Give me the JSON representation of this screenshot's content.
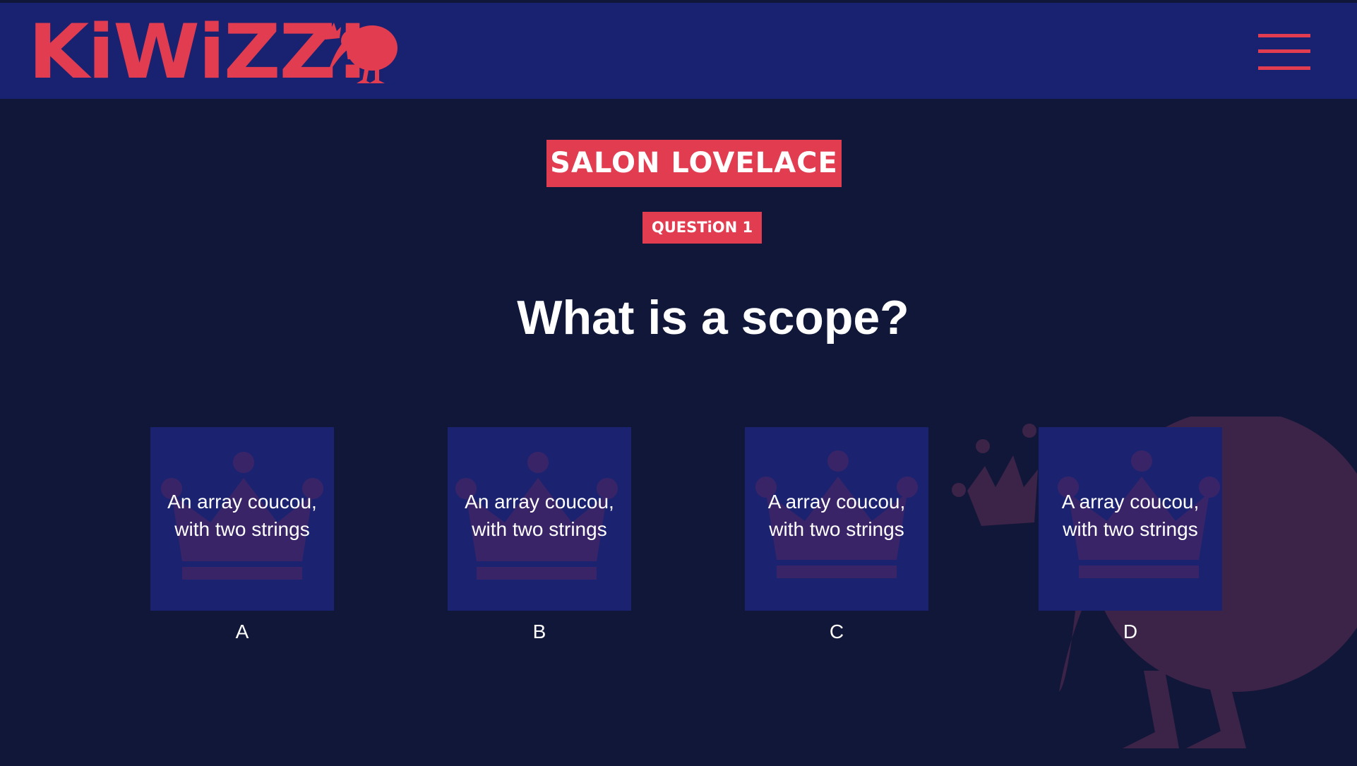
{
  "colors": {
    "background": "#111739",
    "header": "#192271",
    "accent": "#e23c51",
    "card": "#1b2370",
    "crown": "#3a2468",
    "text": "#ffffff"
  },
  "header": {
    "logo_text": "KiWiZZ!",
    "logo_icon": "kiwi-bird-crown-icon",
    "menu_icon": "hamburger-menu-icon"
  },
  "room": {
    "name": "SALON LOVELACE"
  },
  "question": {
    "label": "QUESTiON 1",
    "text": "What is a scope?"
  },
  "answers": [
    {
      "letter": "A",
      "text": "An array coucou, with two strings",
      "icon": "crown-icon"
    },
    {
      "letter": "B",
      "text": "An array coucou, with two strings",
      "icon": "crown-icon"
    },
    {
      "letter": "C",
      "text": "A array coucou, with two strings",
      "icon": "crown-icon"
    },
    {
      "letter": "D",
      "text": "A array coucou, with two strings",
      "icon": "crown-icon"
    }
  ],
  "decor": {
    "background_icon": "kiwi-bird-crown-icon"
  }
}
